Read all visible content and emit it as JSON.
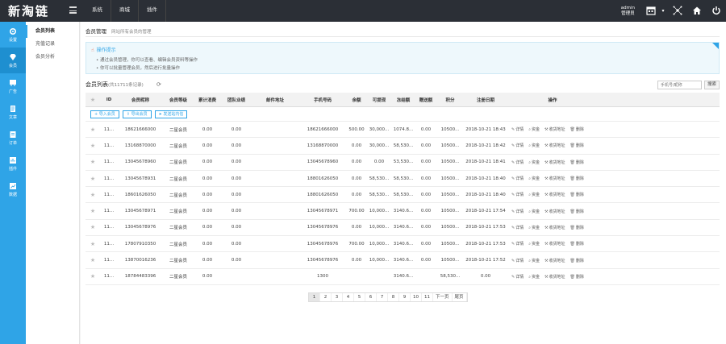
{
  "app": {
    "logo": "新淘链",
    "topnav": [
      "系统",
      "商城",
      "插件"
    ],
    "user": {
      "name": "admin",
      "role": "管理员"
    }
  },
  "leftbar": [
    {
      "label": "设置",
      "icon": "gear-icon"
    },
    {
      "label": "会员",
      "icon": "diamond-icon"
    },
    {
      "label": "广告",
      "icon": "ad-icon"
    },
    {
      "label": "文章",
      "icon": "document-icon"
    },
    {
      "label": "订单",
      "icon": "cart-icon"
    },
    {
      "label": "插件",
      "icon": "plugin-icon"
    },
    {
      "label": "数据",
      "icon": "chart-icon"
    }
  ],
  "subnav": [
    "会员列表",
    "充值记录",
    "会员分析"
  ],
  "page": {
    "title": "会员管理",
    "subtitle": "网站所有会员的管理"
  },
  "tips": {
    "title": "操作提示",
    "lines": [
      "通过会员管理，你可以查看、编辑会员资料等操作",
      "你可以批量管理会员，然后进行批量操作"
    ]
  },
  "list": {
    "title": "会员列表",
    "count": "(共11711条记录)",
    "search_placeholder": "手机号/昵称",
    "search_button": "搜索"
  },
  "toolbar": [
    "导入会员",
    "导出会员",
    "发送站内信"
  ],
  "columns": [
    "",
    "ID",
    "会员昵称",
    "会员等级",
    "累计消费",
    "团队业绩",
    "邮件地址",
    "手机号码",
    "余额",
    "可提现",
    "冻结额",
    "赠送额",
    "积分",
    "注册日期",
    "操作"
  ],
  "rows": [
    {
      "id": "11...",
      "nick": "18621666000",
      "level": "二星会员",
      "consume": "0.00",
      "team": "0.00",
      "email": "",
      "phone": "18621666000",
      "balance": "500.00",
      "withdraw": "30,000...",
      "frozen": "1074.8...",
      "gift": "0.00",
      "points": "10500...",
      "date": "2018-10-21 18:43"
    },
    {
      "id": "11...",
      "nick": "13168870000",
      "level": "二星会员",
      "consume": "0.00",
      "team": "0.00",
      "email": "",
      "phone": "13168870000",
      "balance": "0.00",
      "withdraw": "30,000...",
      "frozen": "58,530...",
      "gift": "0.00",
      "points": "10500...",
      "date": "2018-10-21 18:42"
    },
    {
      "id": "11...",
      "nick": "13045678960",
      "level": "二星会员",
      "consume": "0.00",
      "team": "0.00",
      "email": "",
      "phone": "13045678960",
      "balance": "0.00",
      "withdraw": "0.00",
      "frozen": "53,530...",
      "gift": "0.00",
      "points": "10500...",
      "date": "2018-10-21 18:41"
    },
    {
      "id": "11...",
      "nick": "13045678931",
      "level": "二星会员",
      "consume": "0.00",
      "team": "0.00",
      "email": "",
      "phone": "18801626050",
      "balance": "0.00",
      "withdraw": "58,530...",
      "frozen": "58,530...",
      "gift": "0.00",
      "points": "10500...",
      "date": "2018-10-21 18:40"
    },
    {
      "id": "11...",
      "nick": "18601626050",
      "level": "二星会员",
      "consume": "0.00",
      "team": "0.00",
      "email": "",
      "phone": "18801626050",
      "balance": "0.00",
      "withdraw": "58,530...",
      "frozen": "58,530...",
      "gift": "0.00",
      "points": "10500...",
      "date": "2018-10-21 18:40"
    },
    {
      "id": "11...",
      "nick": "13045678971",
      "level": "二星会员",
      "consume": "0.00",
      "team": "0.00",
      "email": "",
      "phone": "13045678971",
      "balance": "700.00",
      "withdraw": "10,000...",
      "frozen": "3140.6...",
      "gift": "0.00",
      "points": "10500...",
      "date": "2018-10-21 17:54"
    },
    {
      "id": "11...",
      "nick": "13045678976",
      "level": "二星会员",
      "consume": "0.00",
      "team": "0.00",
      "email": "",
      "phone": "13045678976",
      "balance": "0.00",
      "withdraw": "10,000...",
      "frozen": "3140.6...",
      "gift": "0.00",
      "points": "10500...",
      "date": "2018-10-21 17:53"
    },
    {
      "id": "11...",
      "nick": "17807910350",
      "level": "二星会员",
      "consume": "0.00",
      "team": "0.00",
      "email": "",
      "phone": "13045678976",
      "balance": "700.00",
      "withdraw": "10,000...",
      "frozen": "3140.6...",
      "gift": "0.00",
      "points": "10500...",
      "date": "2018-10-21 17:53"
    },
    {
      "id": "11...",
      "nick": "13870016236",
      "level": "二星会员",
      "consume": "0.00",
      "team": "0.00",
      "email": "",
      "phone": "13045678976",
      "balance": "0.00",
      "withdraw": "10,000...",
      "frozen": "3140.6...",
      "gift": "0.00",
      "points": "10500...",
      "date": "2018-10-21 17:52"
    },
    {
      "id": "11...",
      "nick": "18784483396",
      "level": "二星会员",
      "consume": "0.00",
      "team": "",
      "email": "",
      "phone": "1300",
      "balance": "",
      "withdraw": "",
      "frozen": "3140.6...",
      "gift": "",
      "points": "58,530...",
      "date": "0.00"
    }
  ],
  "ops": [
    {
      "label": "详情",
      "icon": "edit-icon"
    },
    {
      "label": "资金",
      "icon": "search-icon"
    },
    {
      "label": "收货地址",
      "icon": "wrench-icon"
    },
    {
      "label": "删除",
      "icon": "trash-icon"
    }
  ],
  "pager": [
    "1",
    "2",
    "3",
    "4",
    "5",
    "6",
    "7",
    "8",
    "9",
    "10",
    "11",
    "下一页",
    "尾页"
  ],
  "current_page": "1"
}
